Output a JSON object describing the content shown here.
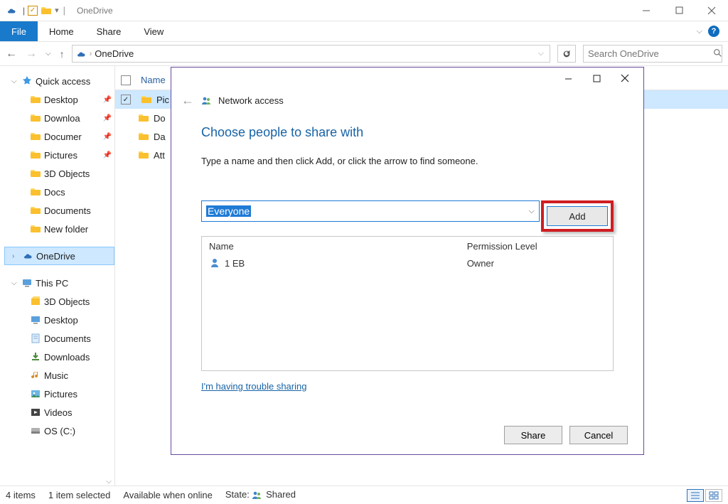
{
  "window": {
    "title": "OneDrive"
  },
  "ribbon": {
    "file": "File",
    "home": "Home",
    "share": "Share",
    "view": "View"
  },
  "address": {
    "root_icon": "onedrive",
    "path": "OneDrive"
  },
  "search": {
    "placeholder": "Search OneDrive"
  },
  "sidebar": {
    "quick_access": "Quick access",
    "items_quick": [
      {
        "label": "Desktop",
        "pinned": true
      },
      {
        "label": "Downloa",
        "pinned": true
      },
      {
        "label": "Documer",
        "pinned": true
      },
      {
        "label": "Pictures",
        "pinned": true
      },
      {
        "label": "3D Objects",
        "pinned": false
      },
      {
        "label": "Docs",
        "pinned": false
      },
      {
        "label": "Documents",
        "pinned": false
      },
      {
        "label": "New folder",
        "pinned": false
      }
    ],
    "onedrive": "OneDrive",
    "this_pc": "This PC",
    "items_pc": [
      {
        "label": "3D Objects"
      },
      {
        "label": "Desktop"
      },
      {
        "label": "Documents"
      },
      {
        "label": "Downloads"
      },
      {
        "label": "Music"
      },
      {
        "label": "Pictures"
      },
      {
        "label": "Videos"
      },
      {
        "label": "OS (C:)"
      }
    ]
  },
  "content": {
    "col_name": "Name",
    "rows": [
      {
        "label": "Pic",
        "selected": true,
        "checked": true
      },
      {
        "label": "Do",
        "sub": true
      },
      {
        "label": "Da",
        "sub": true
      },
      {
        "label": "Att",
        "sub": true
      }
    ]
  },
  "dialog": {
    "title": "Network access",
    "heading": "Choose people to share with",
    "subtitle": "Type a name and then click Add, or click the arrow to find someone.",
    "combo_value": "Everyone",
    "add_label": "Add",
    "col_name": "Name",
    "col_perm": "Permission Level",
    "row_name": "1 EB",
    "row_perm": "Owner",
    "trouble_link": "I'm having trouble sharing",
    "share_btn": "Share",
    "cancel_btn": "Cancel"
  },
  "status": {
    "items": "4 items",
    "selected": "1 item selected",
    "available": "Available when online",
    "state_label": "State:",
    "state_value": "Shared"
  }
}
